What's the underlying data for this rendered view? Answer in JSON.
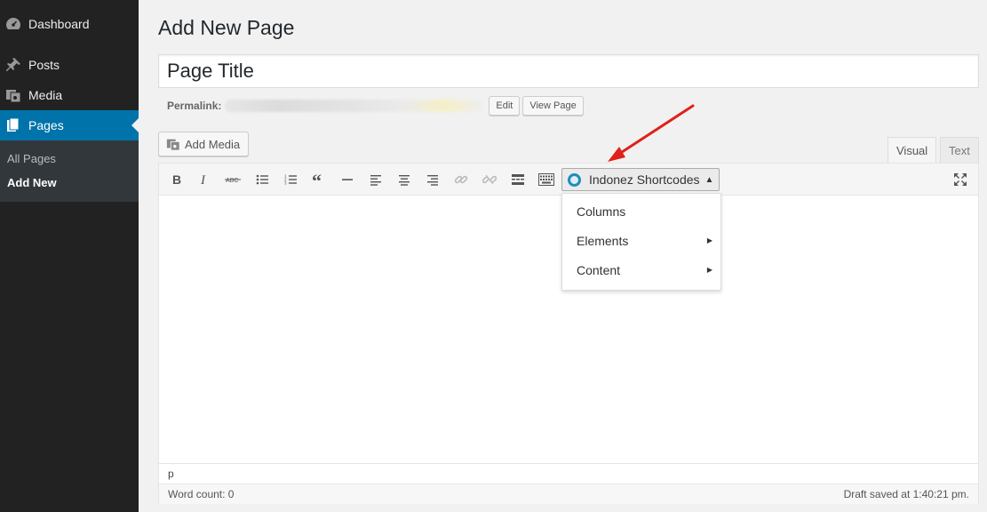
{
  "sidebar": {
    "items": [
      {
        "label": "Dashboard",
        "icon": "dashboard-icon"
      },
      {
        "label": "Posts",
        "icon": "pin-icon"
      },
      {
        "label": "Media",
        "icon": "media-icon"
      },
      {
        "label": "Pages",
        "icon": "pages-icon"
      }
    ],
    "submenu": [
      {
        "label": "All Pages"
      },
      {
        "label": "Add New"
      }
    ]
  },
  "header": {
    "title": "Add New Page"
  },
  "title_field": {
    "value": "Page Title"
  },
  "permalink": {
    "label": "Permalink:",
    "edit_label": "Edit",
    "view_label": "View Page"
  },
  "media": {
    "add_media_label": "Add Media"
  },
  "editor_tabs": {
    "visual": "Visual",
    "text": "Text"
  },
  "toolbar": {
    "buttons": [
      "bold-icon",
      "italic-icon",
      "strikethrough-icon",
      "bullet-list-icon",
      "numbered-list-icon",
      "blockquote-icon",
      "horizontal-line-icon",
      "align-left-icon",
      "align-center-icon",
      "align-right-icon",
      "link-icon",
      "unlink-icon",
      "read-more-icon",
      "toolbar-toggle-icon"
    ],
    "shortcodes_label": "Indonez Shortcodes",
    "fullscreen_icon": "expand-icon"
  },
  "shortcode_menu": {
    "items": [
      {
        "label": "Columns",
        "has_submenu": false
      },
      {
        "label": "Elements",
        "has_submenu": true
      },
      {
        "label": "Content",
        "has_submenu": true
      }
    ]
  },
  "editor": {
    "path": "p",
    "word_count": "Word count: 0",
    "draft_status": "Draft saved at 1:40:21 pm."
  },
  "colors": {
    "sidebar_bg": "#222222",
    "accent": "#0073aa",
    "annotation_arrow": "#e0201b"
  }
}
